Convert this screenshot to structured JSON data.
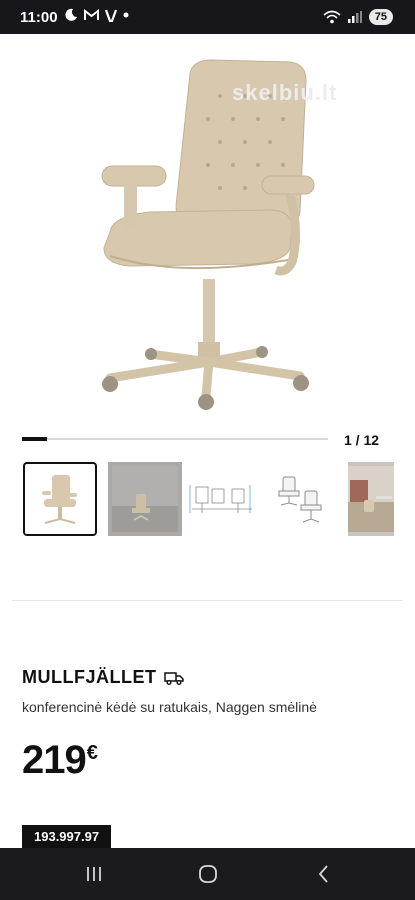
{
  "status_bar": {
    "time": "11:00",
    "left_icons": [
      "moon-icon",
      "gmail-icon",
      "v-app-icon",
      "notification-dot-icon"
    ],
    "right_icons": [
      "wifi-icon",
      "signal-icon",
      "battery-icon"
    ],
    "battery_level": "75"
  },
  "gallery": {
    "watermark": "skelbiu.lt",
    "counter": "1 / 12",
    "current_index": 1,
    "total": 12,
    "progress_fraction": 0.083,
    "thumbnails": [
      {
        "alt": "chair front"
      },
      {
        "alt": "chair in room"
      },
      {
        "alt": "dimension diagram"
      },
      {
        "alt": "chair angles"
      },
      {
        "alt": "office scene"
      }
    ]
  },
  "product": {
    "name": "MULLFJÄLLET",
    "delivery_icon": "truck-icon",
    "description": "konferencinė kėdė su ratukais, Naggen smėlinė",
    "price": "219",
    "currency": "€",
    "code": "193.997.97"
  },
  "nav": {
    "buttons": [
      "recent-apps-icon",
      "home-icon",
      "back-icon"
    ]
  },
  "colors": {
    "status_bar_bg": "#17171b",
    "nav_bar_bg": "#1b1b1f",
    "chair_beige": "#d8c9ae"
  }
}
